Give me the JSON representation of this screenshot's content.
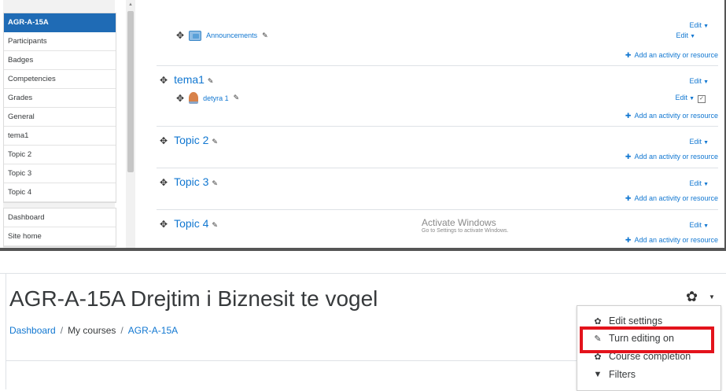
{
  "drawer": {
    "items": [
      "AGR-A-15A",
      "Participants",
      "Badges",
      "Competencies",
      "Grades",
      "General",
      "tema1",
      "Topic 2",
      "Topic 3",
      "Topic 4"
    ],
    "items2": [
      "Dashboard",
      "Site home"
    ]
  },
  "course_sections": {
    "general": {
      "activity": "Announcements",
      "edit_section": "Edit",
      "edit_activity": "Edit",
      "add": "Add an activity or resource"
    },
    "tema1": {
      "title": "tema1",
      "activity": "detyra 1",
      "edit_section": "Edit",
      "edit_activity": "Edit",
      "add": "Add an activity or resource"
    },
    "topic2": {
      "title": "Topic 2",
      "edit": "Edit",
      "add": "Add an activity or resource"
    },
    "topic3": {
      "title": "Topic 3",
      "edit": "Edit",
      "add": "Add an activity or resource"
    },
    "topic4": {
      "title": "Topic 4",
      "edit": "Edit",
      "add": "Add an activity or resource"
    }
  },
  "watermark": {
    "line1": "Activate Windows",
    "line2": "Go to Settings to activate Windows."
  },
  "header": {
    "course_title": "AGR-A-15A Drejtim i Biznesit te vogel",
    "breadcrumb": [
      "Dashboard",
      "My courses",
      "AGR-A-15A"
    ],
    "breadcrumb_sep": "/"
  },
  "settings_menu": {
    "items": [
      "Edit settings",
      "Turn editing on",
      "Course completion",
      "Filters"
    ],
    "highlighted": "Turn editing on"
  },
  "colors": {
    "accent": "#1177d1",
    "active_nav": "#1f6bb5",
    "highlight": "#e3131c"
  }
}
